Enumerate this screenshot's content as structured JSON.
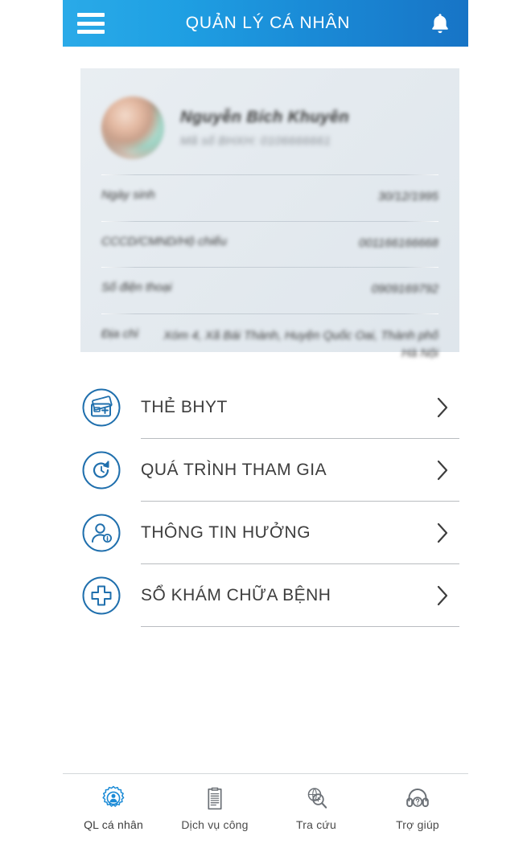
{
  "header": {
    "title": "QUẢN LÝ CÁ NHÂN",
    "menu_icon": "hamburger-icon",
    "notification_icon": "bell-icon",
    "gradient_from": "#2aaae8",
    "gradient_to": "#1774c6"
  },
  "profile": {
    "avatar_icon": "user-avatar-photo",
    "name": "Nguyễn Bích Khuyên",
    "code_line": "Mã số BHXH: 0106666661",
    "rows": [
      {
        "label": "Ngày sinh",
        "value": "30/12/1995"
      },
      {
        "label": "CCCD/CMND/Hộ chiếu",
        "value": "001166166668"
      },
      {
        "label": "Số điện thoại",
        "value": "0909169792"
      },
      {
        "label": "Địa chỉ",
        "value": "Xóm 4, Xã Bái Thành, Huyện Quốc Oai, Thành phố Hà Nội"
      }
    ]
  },
  "menu": {
    "items": [
      {
        "label": "THẺ BHYT",
        "icon": "health-insurance-card-icon"
      },
      {
        "label": "QUÁ TRÌNH THAM GIA",
        "icon": "history-clock-icon"
      },
      {
        "label": "THÔNG TIN HƯỞNG",
        "icon": "person-info-icon"
      },
      {
        "label": "SỔ KHÁM CHỮA BỆNH",
        "icon": "medical-cross-icon"
      }
    ],
    "chevron_icon": "chevron-right-icon",
    "accent_color": "#1f6fad"
  },
  "tabbar": {
    "items": [
      {
        "label": "QL cá nhân",
        "icon": "gear-person-icon",
        "active": true
      },
      {
        "label": "Dịch vụ công",
        "icon": "document-icon",
        "active": false
      },
      {
        "label": "Tra cứu",
        "icon": "globe-search-icon",
        "active": false
      },
      {
        "label": "Trợ giúp",
        "icon": "headset-help-icon",
        "active": false
      }
    ],
    "active_color": "#1a8ad6",
    "inactive_color": "#6b7076"
  }
}
